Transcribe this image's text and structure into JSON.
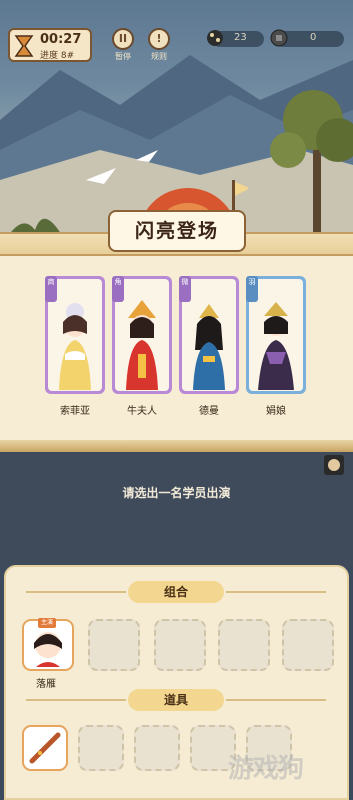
{
  "hud": {
    "timer": "00:27",
    "progress": "进度 8#",
    "pause_label": "暂停",
    "rules_label": "规则",
    "pause_icon_glyph": "II",
    "rules_icon_glyph": "!",
    "cookie_count": "23",
    "coin_count": "0"
  },
  "banner": {
    "title": "闪亮登场"
  },
  "cards": [
    {
      "name": "索菲亚",
      "role": "商",
      "color": "#b88ad6"
    },
    {
      "name": "牛夫人",
      "role": "角",
      "color": "#b88ad6"
    },
    {
      "name": "德曼",
      "role": "微",
      "color": "#b88ad6"
    },
    {
      "name": "娟娘",
      "role": "羽",
      "color": "#7bb0dc"
    }
  ],
  "prompt": "请选出一名学员出演",
  "panel": {
    "group_label": "组合",
    "props_label": "道具",
    "selected_member": {
      "name": "落雁",
      "badge": "主演"
    }
  },
  "watermark": "游戏狗",
  "colors": {
    "accent": "#f3d690",
    "card_purple": "#b88ad6",
    "card_blue": "#7bb0dc"
  }
}
